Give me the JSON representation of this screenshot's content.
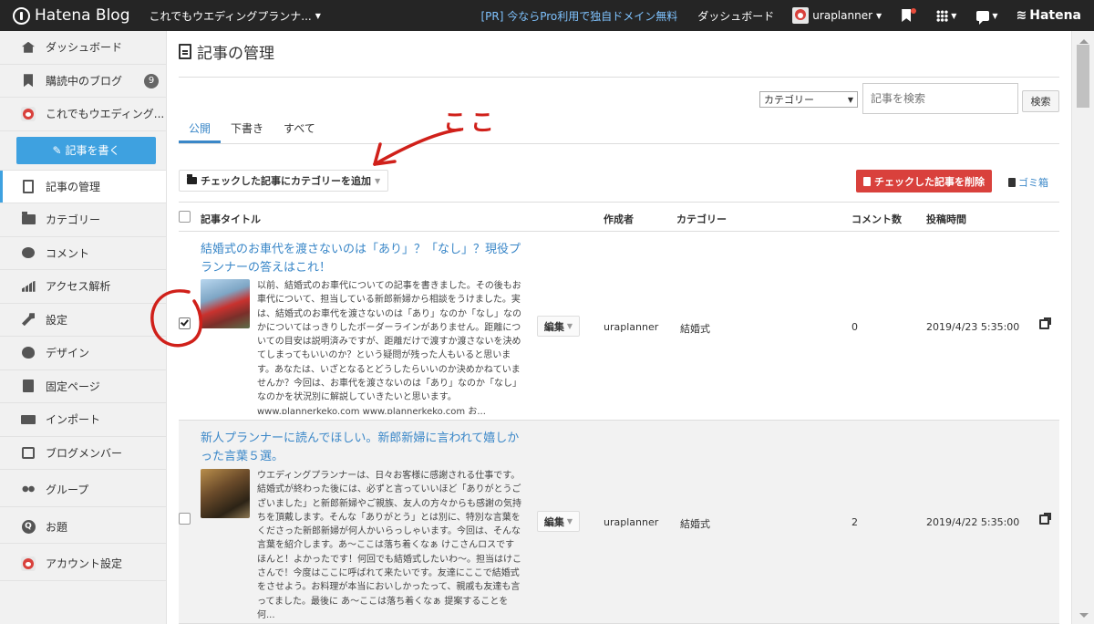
{
  "topbar": {
    "logo_text": "Hatena Blog",
    "blog_name": "これでもウエディングプランナ...",
    "pr_text": "[PR] 今ならPro利用で独自ドメイン無料",
    "dashboard": "ダッシュボード",
    "username": "uraplanner",
    "hatena": "Hatena"
  },
  "sidebar": {
    "dashboard": "ダッシュボード",
    "subscriptions": "購読中のブログ",
    "subscriptions_count": "9",
    "blog": "これでもウエディング...",
    "write_button": "記事を書く",
    "manage_posts": "記事の管理",
    "categories": "カテゴリー",
    "comments": "コメント",
    "analytics": "アクセス解析",
    "settings": "設定",
    "design": "デザイン",
    "fixed_pages": "固定ページ",
    "import": "インポート",
    "blog_members": "ブログメンバー",
    "groups": "グループ",
    "topics": "お題",
    "account": "アカウント設定"
  },
  "main": {
    "title": "記事の管理",
    "category_select": "カテゴリー",
    "search_placeholder": "記事を検索",
    "search_button": "検索",
    "tabs": [
      "公開",
      "下書き",
      "すべて"
    ],
    "annotation": "ここ",
    "add_category_button": "チェックした記事にカテゴリーを追加",
    "delete_button": "チェックした記事を削除",
    "trash_link": "ゴミ箱",
    "columns": {
      "title": "記事タイトル",
      "author": "作成者",
      "category": "カテゴリー",
      "comments": "コメント数",
      "posted": "投稿時間"
    },
    "posts": [
      {
        "title": "結婚式のお車代を渡さないのは「あり」？「なし」？現役プランナーの答えはこれ！",
        "excerpt": "以前、結婚式のお車代についての記事を書きました。その後もお車代について、担当している新郎新婦から相談をうけました。実は、結婚式のお車代を渡さないのは「あり」なのか「なし」なのかについてはっきりしたボーダーラインがありません。距離についての目安は説明済みですが、距離だけで渡すか渡さないを決めてしまってもいいのか？という疑問が残った人もいると思います。あなたは、いざとなるとどうしたらいいのか決めかねていませんか？今回は、お車代を渡さないのは「あり」なのか「なし」なのかを状況別に解説していきたいと思います。www.plannerkeko.com www.plannerkeko.com お...",
        "edit": "編集",
        "author": "uraplanner",
        "category": "結婚式",
        "comments": "0",
        "posted": "2019/4/23 5:35:00",
        "checked": true
      },
      {
        "title": "新人プランナーに読んでほしい。新郎新婦に言われて嬉しかった言葉５選。",
        "excerpt": "ウエディングプランナーは、日々お客様に感謝される仕事です。結婚式が終わった後には、必ずと言っていいほど「ありがとうございました」と新郎新婦やご親族、友人の方々からも感謝の気持ちを頂戴します。そんな「ありがとう」とは別に、特別な言葉をくださった新郎新婦が何人かいらっしゃいます。今回は、そんな言葉を紹介します。あ～ここは落ち着くなぁ けこさんロスです ほんと！よかったです！何回でも結婚式したいわ～。担当はけこさんで！今度はここに呼ばれて来たいです。友達にここで結婚式をさせよう。お料理が本当においしかったって、親戚も友達も言ってました。最後に あ～ここは落ち着くなぁ 提案することを何...",
        "edit": "編集",
        "author": "uraplanner",
        "category": "結婚式",
        "comments": "2",
        "posted": "2019/4/22 5:35:00",
        "checked": false
      }
    ]
  },
  "colors": {
    "accent": "#3ea1e0",
    "link": "#3a87c8",
    "danger": "#d9413c",
    "annotation_red": "#d0201a"
  }
}
